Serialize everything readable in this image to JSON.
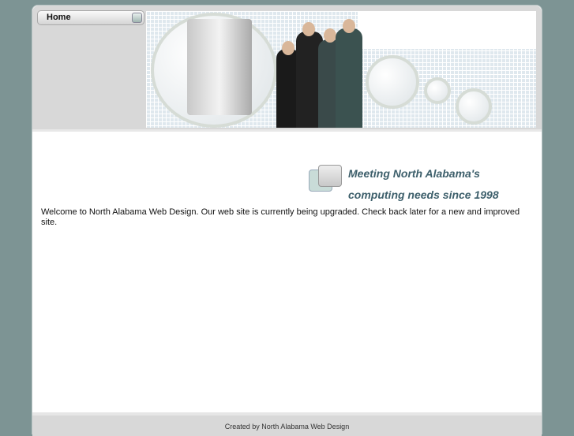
{
  "nav": {
    "home_label": "Home"
  },
  "tagline": {
    "line1": "Meeting North Alabama's",
    "line2": "computing needs since 1998"
  },
  "main": {
    "welcome": "Welcome to North Alabama Web Design.  Our web site is currently being upgraded.  Check back later for a new and improved site."
  },
  "footer": {
    "text": "Created by North Alabama Web Design"
  }
}
